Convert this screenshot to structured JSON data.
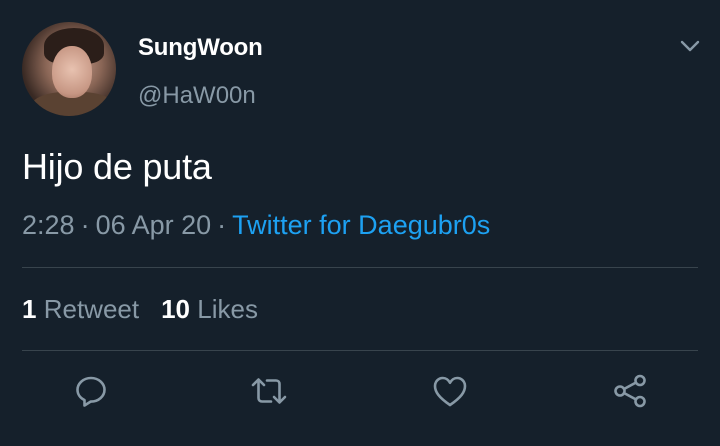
{
  "user": {
    "display_name": "SungWoon",
    "handle": "@HaW00n"
  },
  "tweet": {
    "text": "Hijo de puta",
    "time": "2:28",
    "date": "06 Apr 20",
    "separator": "·",
    "source": "Twitter for Daegubr0s"
  },
  "stats": {
    "retweets_count": "1",
    "retweets_label": "Retweet",
    "likes_count": "10",
    "likes_label": "Likes"
  },
  "icons": {
    "menu": "chevron-down-icon",
    "reply": "reply-icon",
    "retweet": "retweet-icon",
    "like": "heart-icon",
    "share": "share-icon"
  },
  "colors": {
    "background": "#15202b",
    "muted_text": "#8899a6",
    "link": "#1da1f2",
    "divider": "#38444d"
  }
}
